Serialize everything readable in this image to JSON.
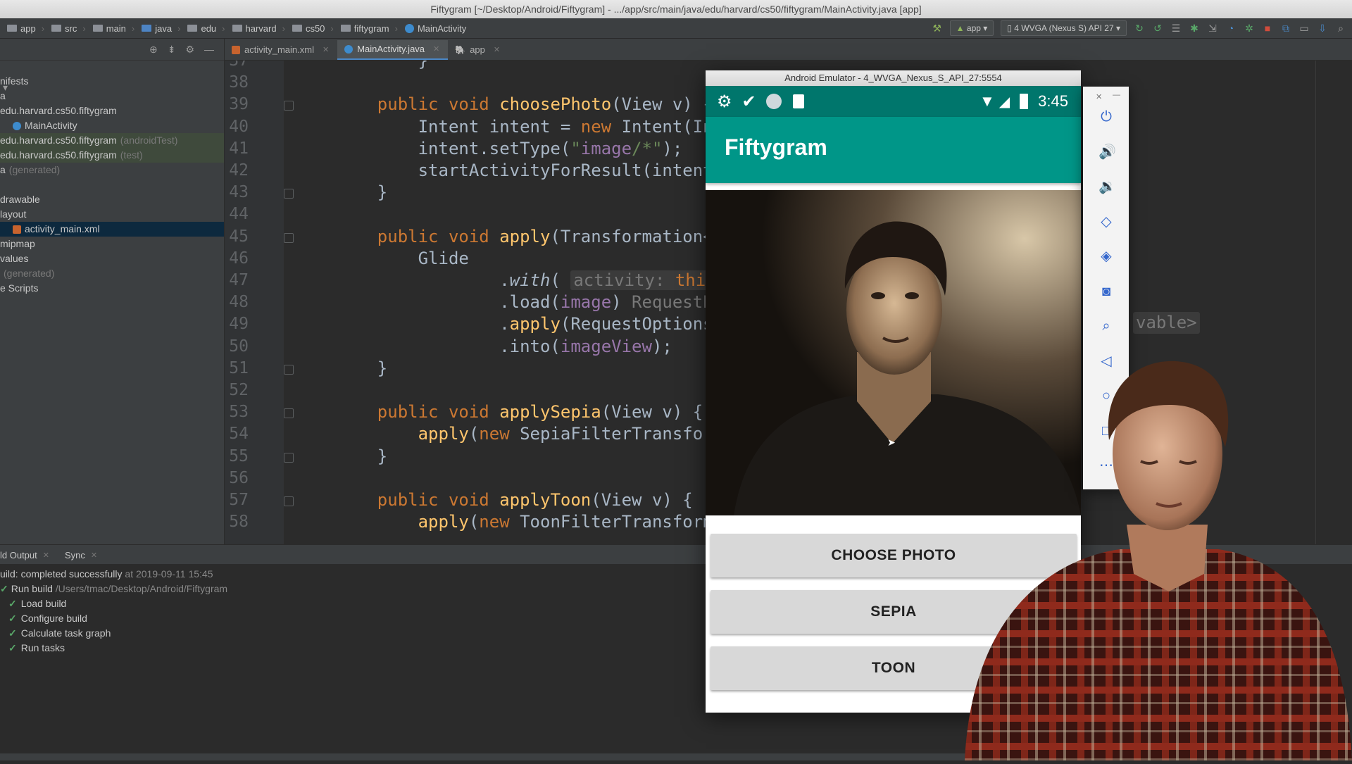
{
  "window": {
    "title": "Fiftygram [~/Desktop/Android/Fiftygram] - .../app/src/main/java/edu/harvard/cs50/fiftygram/MainActivity.java [app]"
  },
  "breadcrumb": [
    "app",
    "src",
    "main",
    "java",
    "edu",
    "harvard",
    "cs50",
    "fiftygram",
    "MainActivity"
  ],
  "toolbar": {
    "run_config": "app",
    "device": "4  WVGA (Nexus S) API 27"
  },
  "project_tree": [
    {
      "label": "nifests",
      "muted": ""
    },
    {
      "label": "a",
      "muted": ""
    },
    {
      "label": "edu.harvard.cs50.fiftygram",
      "muted": ""
    },
    {
      "label": "MainActivity",
      "muted": ""
    },
    {
      "label": "edu.harvard.cs50.fiftygram",
      "muted": "(androidTest)"
    },
    {
      "label": "edu.harvard.cs50.fiftygram",
      "muted": "(test)"
    },
    {
      "label": "a",
      "muted": "(generated)"
    },
    {
      "label": "",
      "muted": ""
    },
    {
      "label": "drawable",
      "muted": ""
    },
    {
      "label": "layout",
      "muted": ""
    },
    {
      "label": "activity_main.xml",
      "muted": ""
    },
    {
      "label": "mipmap",
      "muted": ""
    },
    {
      "label": "values",
      "muted": ""
    },
    {
      "label": "",
      "muted": "(generated)"
    },
    {
      "label": "e Scripts",
      "muted": ""
    }
  ],
  "tabs": [
    "activity_main.xml",
    "MainActivity.java",
    "app"
  ],
  "code": [
    {
      "n": "37",
      "t": "        }"
    },
    {
      "n": "38",
      "t": ""
    },
    {
      "n": "39",
      "t": "    public void choosePhoto(View v) {"
    },
    {
      "n": "40",
      "t": "        Intent intent = new Intent(Inten"
    },
    {
      "n": "41",
      "t": "        intent.setType(\"image/*\");"
    },
    {
      "n": "42",
      "t": "        startActivityForResult(intent,  r"
    },
    {
      "n": "43",
      "t": "    }"
    },
    {
      "n": "44",
      "t": ""
    },
    {
      "n": "45",
      "t": "    public void apply(Transformation<Bitm"
    },
    {
      "n": "46",
      "t": "        Glide"
    },
    {
      "n": "47",
      "t": "                .with( activity: this) Requ"
    },
    {
      "n": "48",
      "t": "                .load(image) RequestBuild"
    },
    {
      "n": "49",
      "t": "                .apply(RequestOptions.bi"
    },
    {
      "n": "50",
      "t": "                .into(imageView);"
    },
    {
      "n": "51",
      "t": "    }"
    },
    {
      "n": "52",
      "t": ""
    },
    {
      "n": "53",
      "t": "    public void applySepia(View v) {"
    },
    {
      "n": "54",
      "t": "        apply(new SepiaFilterTransformat"
    },
    {
      "n": "55",
      "t": "    }"
    },
    {
      "n": "56",
      "t": ""
    },
    {
      "n": "57",
      "t": "    public void applyToon(View v) {"
    },
    {
      "n": "58",
      "t": "        apply(new ToonFilterTransformati"
    }
  ],
  "code_fragment_right": "vable>",
  "bottom_tabs": [
    "ld Output",
    "Sync"
  ],
  "build": {
    "line1": "uild: completed successfully",
    "line1_time": "at 2019-09-11 15:45",
    "run_build": "Run build",
    "run_build_path": "/Users/tmac/Desktop/Android/Fiftygram",
    "steps": [
      "Load build",
      "Configure build",
      "Calculate task graph",
      "Run tasks"
    ]
  },
  "emulator": {
    "title": "Android Emulator - 4_WVGA_Nexus_S_API_27:5554",
    "time": "3:45",
    "app_title": "Fiftygram",
    "buttons": [
      "CHOOSE PHOTO",
      "SEPIA",
      "TOON"
    ],
    "side_icons": [
      "power-icon",
      "volume-up-icon",
      "volume-down-icon",
      "rotate-left-icon",
      "rotate-right-icon",
      "camera-icon",
      "zoom-icon",
      "back-icon",
      "home-icon",
      "overview-icon",
      "more-icon"
    ]
  },
  "colors": {
    "accent": "#009688",
    "status": "#00766c",
    "ide_bg": "#2b2b2b"
  }
}
